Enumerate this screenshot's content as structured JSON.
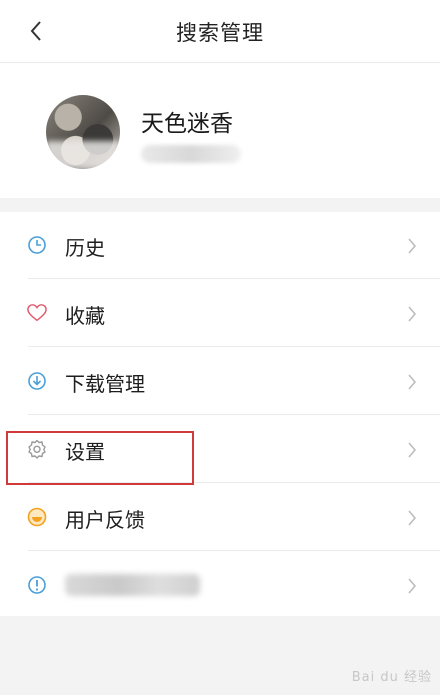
{
  "header": {
    "title": "搜索管理",
    "back_icon": "chevron-left-icon"
  },
  "profile": {
    "username": "天色迷香"
  },
  "menu": {
    "items": [
      {
        "label": "历史",
        "icon": "clock-icon",
        "icon_color": "#4a9fd8"
      },
      {
        "label": "收藏",
        "icon": "heart-icon",
        "icon_color": "#e05a6b"
      },
      {
        "label": "下载管理",
        "icon": "download-icon",
        "icon_color": "#4a9fd8"
      },
      {
        "label": "设置",
        "icon": "gear-icon",
        "icon_color": "#9a9a9a"
      },
      {
        "label": "用户反馈",
        "icon": "feedback-icon",
        "icon_color": "#f2a21c"
      },
      {
        "label": "",
        "icon": "info-icon",
        "icon_color": "#4a9fd8"
      }
    ]
  },
  "annotation": {
    "highlight_color": "#d13a3a"
  },
  "watermark": {
    "text": "Bai du 经验"
  }
}
